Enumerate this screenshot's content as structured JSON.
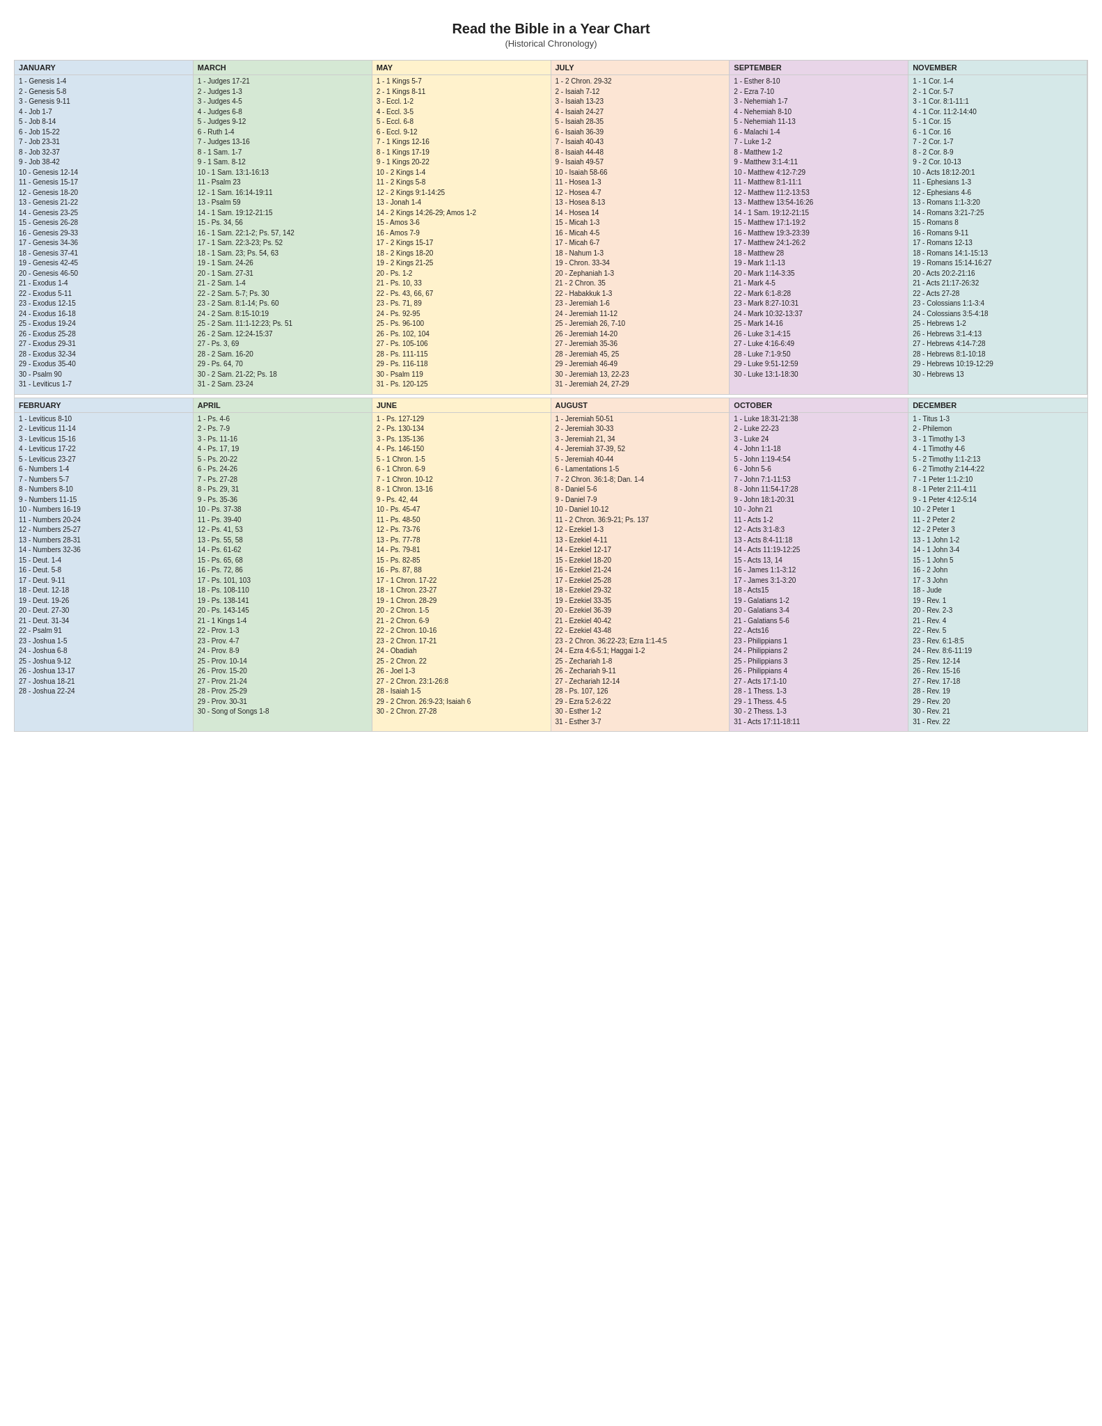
{
  "title": "Read the Bible in a Year Chart",
  "subtitle": "(Historical Chronology)",
  "months": {
    "january": {
      "label": "JANUARY",
      "entries": [
        "1 - Genesis 1-4",
        "2 - Genesis 5-8",
        "3 - Genesis 9-11",
        "4 - Job 1-7",
        "5 - Job 8-14",
        "6 - Job 15-22",
        "7 - Job 23-31",
        "8 - Job 32-37",
        "9 - Job 38-42",
        "10 - Genesis 12-14",
        "11 - Genesis 15-17",
        "12 - Genesis 18-20",
        "13 - Genesis 21-22",
        "14 - Genesis 23-25",
        "15 - Genesis 26-28",
        "16 - Genesis 29-33",
        "17 - Genesis 34-36",
        "18 - Genesis 37-41",
        "19 - Genesis 42-45",
        "20 - Genesis 46-50",
        "21 - Exodus 1-4",
        "22 - Exodus 5-11",
        "23 - Exodus 12-15",
        "24 - Exodus 16-18",
        "25 - Exodus 19-24",
        "26 - Exodus 25-28",
        "27 - Exodus 29-31",
        "28 - Exodus 32-34",
        "29 - Exodus 35-40",
        "30 - Psalm 90",
        "31 - Leviticus 1-7"
      ]
    },
    "february": {
      "label": "FEBRUARY",
      "entries": [
        "1 - Leviticus 8-10",
        "2 - Leviticus 11-14",
        "3 - Leviticus 15-16",
        "4 - Leviticus 17-22",
        "5 - Leviticus 23-27",
        "6 - Numbers 1-4",
        "7 - Numbers 5-7",
        "8 - Numbers 8-10",
        "9 - Numbers 11-15",
        "10 - Numbers 16-19",
        "11 - Numbers 20-24",
        "12 - Numbers 25-27",
        "13 - Numbers 28-31",
        "14 - Numbers 32-36",
        "15 - Deut. 1-4",
        "16 - Deut. 5-8",
        "17 - Deut. 9-11",
        "18 - Deut. 12-18",
        "19 - Deut. 19-26",
        "20 - Deut. 27-30",
        "21 - Deut. 31-34",
        "22 - Psalm 91",
        "23 - Joshua 1-5",
        "24 - Joshua 6-8",
        "25 - Joshua 9-12",
        "26 - Joshua 13-17",
        "27 - Joshua 18-21",
        "28 - Joshua 22-24"
      ]
    },
    "march": {
      "label": "MARCH",
      "entries": [
        "1 - Judges 17-21",
        "2 - Judges 1-3",
        "3 - Judges 4-5",
        "4 - Judges 6-8",
        "5 - Judges 9-12",
        "6 - Ruth 1-4",
        "7 - Judges 13-16",
        "8 - 1 Sam. 1-7",
        "9 - 1 Sam. 8-12",
        "10 - 1 Sam. 13:1-16:13",
        "11 - Psalm 23",
        "12 - 1 Sam. 16:14-19:11",
        "13 - Psalm 59",
        "14 - 1 Sam. 19:12-21:15",
        "15 - Ps. 34, 56",
        "16 - 1 Sam. 22:1-2; Ps. 57, 142",
        "17 - 1 Sam. 22:3-23; Ps. 52",
        "18 - 1 Sam. 23; Ps. 54, 63",
        "19 - 1 Sam. 24-26",
        "20 - 1 Sam. 27-31",
        "21 - 2 Sam. 1-4",
        "22 - 2 Sam. 5-7; Ps. 30",
        "23 - 2 Sam. 8:1-14; Ps. 60",
        "24 - 2 Sam. 8:15-10:19",
        "25 - 2 Sam. 11:1-12:23; Ps. 51",
        "26 - 2 Sam. 12:24-15:37",
        "27 - Ps. 3, 69",
        "28 - 2 Sam. 16-20",
        "29 - Ps. 64, 70",
        "30 - 2 Sam. 21-22; Ps. 18",
        "31 - 2 Sam. 23-24"
      ]
    },
    "april": {
      "label": "APRIL",
      "entries": [
        "1 - Ps. 4-6",
        "2 - Ps. 7-9",
        "3 - Ps. 11-16",
        "4 - Ps. 17, 19",
        "5 - Ps. 20-22",
        "6 - Ps. 24-26",
        "7 - Ps. 27-28",
        "8 - Ps. 29, 31",
        "9 - Ps. 35-36",
        "10 - Ps. 37-38",
        "11 - Ps. 39-40",
        "12 - Ps. 41, 53",
        "13 - Ps. 55, 58",
        "14 - Ps. 61-62",
        "15 - Ps. 65, 68",
        "16 - Ps. 72, 86",
        "17 - Ps. 101, 103",
        "18 - Ps. 108-110",
        "19 - Ps. 138-141",
        "20 - Ps. 143-145",
        "21 - 1 Kings 1-4",
        "22 - Prov. 1-3",
        "23 - Prov. 4-7",
        "24 - Prov. 8-9",
        "25 - Prov. 10-14",
        "26 - Prov. 15-20",
        "27 - Prov. 21-24",
        "28 - Prov. 25-29",
        "29 - Prov. 30-31",
        "30 - Song of Songs 1-8"
      ]
    },
    "may": {
      "label": "MAY",
      "entries": [
        "1 - 1 Kings 5-7",
        "2 - 1 Kings 8-11",
        "3 - Eccl. 1-2",
        "4 - Eccl. 3-5",
        "5 - Eccl. 6-8",
        "6 - Eccl. 9-12",
        "7 - 1 Kings 12-16",
        "8 - 1 Kings 17-19",
        "9 - 1 Kings 20-22",
        "10 - 2 Kings 1-4",
        "11 - 2 Kings 5-8",
        "12 - 2 Kings 9:1-14:25",
        "13 - Jonah 1-4",
        "14 - 2 Kings 14:26-29; Amos 1-2",
        "15 - Amos 3-6",
        "16 - Amos 7-9",
        "17 - 2 Kings 15-17",
        "18 - 2 Kings 18-20",
        "19 - 2 Kings 21-25",
        "20 - Ps. 1-2",
        "21 - Ps. 10, 33",
        "22 - Ps. 43, 66, 67",
        "23 - Ps. 71, 89",
        "24 - Ps. 92-95",
        "25 - Ps. 96-100",
        "26 - Ps. 102, 104",
        "27 - Ps. 105-106",
        "28 - Ps. 111-115",
        "29 - Ps. 116-118",
        "30 - Psalm 119",
        "31 - Ps. 120-125"
      ]
    },
    "june": {
      "label": "JUNE",
      "entries": [
        "1 - Ps. 127-129",
        "2 - Ps. 130-134",
        "3 - Ps. 135-136",
        "4 - Ps. 146-150",
        "5 - 1 Chron. 1-5",
        "6 - 1 Chron. 6-9",
        "7 - 1 Chron. 10-12",
        "8 - 1 Chron. 13-16",
        "9 - Ps. 42, 44",
        "10 - Ps. 45-47",
        "11 - Ps. 48-50",
        "12 - Ps. 73-76",
        "13 - Ps. 77-78",
        "14 - Ps. 79-81",
        "15 - Ps. 82-85",
        "16 - Ps. 87, 88",
        "17 - 1 Chron. 17-22",
        "18 - 1 Chron. 23-27",
        "19 - 1 Chron. 28-29",
        "20 - 2 Chron. 1-5",
        "21 - 2 Chron. 6-9",
        "22 - 2 Chron. 10-16",
        "23 - 2 Chron. 17-21",
        "24 - Obadiah",
        "25 - 2 Chron. 22",
        "26 - Joel 1-3",
        "27 - 2 Chron. 23:1-26:8",
        "28 - Isaiah 1-5",
        "29 - 2 Chron. 26:9-23; Isaiah 6",
        "30 - 2 Chron. 27-28"
      ]
    },
    "july": {
      "label": "JULY",
      "entries": [
        "1 - 2 Chron. 29-32",
        "2 - Isaiah 7-12",
        "3 - Isaiah 13-23",
        "4 - Isaiah 24-27",
        "5 - Isaiah 28-35",
        "6 - Isaiah 36-39",
        "7 - Isaiah 40-43",
        "8 - Isaiah 44-48",
        "9 - Isaiah 49-57",
        "10 - Isaiah 58-66",
        "11 - Hosea 1-3",
        "12 - Hosea 4-7",
        "13 - Hosea 8-13",
        "14 - Hosea 14",
        "15 - Micah 1-3",
        "16 - Micah 4-5",
        "17 - Micah 6-7",
        "18 - Nahum 1-3",
        "19 - Chron. 33-34",
        "20 - Zephaniah 1-3",
        "21 - 2 Chron. 35",
        "22 - Habakkuk 1-3",
        "23 - Jeremiah 1-6",
        "24 - Jeremiah 11-12",
        "25 - Jeremiah 26, 7-10",
        "26 - Jeremiah 14-20",
        "27 - Jeremiah 35-36",
        "28 - Jeremiah 45, 25",
        "29 - Jeremiah 46-49",
        "30 - Jeremiah 13, 22-23",
        "31 - Jeremiah 24, 27-29"
      ]
    },
    "august": {
      "label": "AUGUST",
      "entries": [
        "1 - Jeremiah 50-51",
        "2 - Jeremiah 30-33",
        "3 - Jeremiah 21, 34",
        "4 - Jeremiah 37-39, 52",
        "5 - Jeremiah 40-44",
        "6 - Lamentations 1-5",
        "7 - 2 Chron. 36:1-8; Dan. 1-4",
        "8 - Daniel 5-6",
        "9 - Daniel 7-9",
        "10 - Daniel 10-12",
        "11 - 2 Chron. 36:9-21; Ps. 137",
        "12 - Ezekiel 1-3",
        "13 - Ezekiel 4-11",
        "14 - Ezekiel 12-17",
        "15 - Ezekiel 18-20",
        "16 - Ezekiel 21-24",
        "17 - Ezekiel 25-28",
        "18 - Ezekiel 29-32",
        "19 - Ezekiel 33-35",
        "20 - Ezekiel 36-39",
        "21 - Ezekiel 40-42",
        "22 - Ezekiel 43-48",
        "23 - 2 Chron. 36:22-23; Ezra 1:1-4:5",
        "24 - Ezra 4:6-5:1; Haggai 1-2",
        "25 - Zechariah 1-8",
        "26 - Zechariah 9-11",
        "27 - Zechariah 12-14",
        "28 - Ps. 107, 126",
        "29 - Ezra 5:2-6:22",
        "30 - Esther 1-2",
        "31 - Esther 3-7"
      ]
    },
    "september": {
      "label": "SEPTEMBER",
      "entries": [
        "1 - Esther 8-10",
        "2 - Ezra 7-10",
        "3 - Nehemiah 1-7",
        "4 - Nehemiah 8-10",
        "5 - Nehemiah 11-13",
        "6 - Malachi 1-4",
        "7 - Luke 1-2",
        "8 - Matthew 1-2",
        "9 - Matthew 3:1-4:11",
        "10 - Matthew 4:12-7:29",
        "11 - Matthew 8:1-11:1",
        "12 - Matthew 11:2-13:53",
        "13 - Matthew 13:54-16:26",
        "14 - 1 Sam. 19:12-21:15",
        "15 - Matthew 17:1-19:2",
        "16 - Matthew 19:3-23:39",
        "17 - Matthew 24:1-26:2",
        "18 - Matthew 28",
        "19 - Mark 1:1-13",
        "20 - Mark 1:14-3:35",
        "21 - Mark 4-5",
        "22 - Mark 6:1-8:28",
        "23 - Mark 8:27-10:31",
        "24 - Mark 10:32-13:37",
        "25 - Mark 14-16",
        "26 - Luke 3:1-4:15",
        "27 - Luke 4:16-6:49",
        "28 - Luke 7:1-9:50",
        "29 - Luke 9:51-12:59",
        "30 - Luke 13:1-18:30"
      ]
    },
    "october": {
      "label": "OCTOBER",
      "entries": [
        "1 - Luke 18:31-21:38",
        "2 - Luke 22-23",
        "3 - Luke 24",
        "4 - John 1:1-18",
        "5 - John 1:19-4:54",
        "6 - John 5-6",
        "7 - John 7:1-11:53",
        "8 - John 11:54-17:28",
        "9 - John 18:1-20:31",
        "10 - John 21",
        "11 - Acts 1-2",
        "12 - Acts 3:1-8:3",
        "13 - Acts 8:4-11:18",
        "14 - Acts 11:19-12:25",
        "15 - Acts 13, 14",
        "16 - James 1:1-3:12",
        "17 - James 3:1-3:20",
        "18 - Acts15",
        "19 - Galatians 1-2",
        "20 - Galatians 3-4",
        "21 - Galatians 5-6",
        "22 - Acts16",
        "23 - Philippians 1",
        "24 - Philippians 2",
        "25 - Philippians 3",
        "26 - Philippians 4",
        "27 - Acts 17:1-10",
        "28 - 1 Thess. 1-3",
        "29 - 1 Thess. 4-5",
        "30 - 2 Thess. 1-3",
        "31 - Acts 17:11-18:11"
      ]
    },
    "november": {
      "label": "NOVEMBER",
      "entries": [
        "1 - 1 Cor. 1-4",
        "2 - 1 Cor. 5-7",
        "3 - 1 Cor. 8:1-11:1",
        "4 - 1 Cor. 11:2-14:40",
        "5 - 1 Cor. 15",
        "6 - 1 Cor. 16",
        "7 - 2 Cor. 1-7",
        "8 - 2 Cor. 8-9",
        "9 - 2 Cor. 10-13",
        "10 - Acts 18:12-20:1",
        "11 - Ephesians 1-3",
        "12 - Ephesians 4-6",
        "13 - Romans 1:1-3:20",
        "14 - Romans 3:21-7:25",
        "15 - Romans 8",
        "16 - Romans 9-11",
        "17 - Romans 12-13",
        "18 - Romans 14:1-15:13",
        "19 - Romans 15:14-16:27",
        "20 - Acts 20:2-21:16",
        "21 - Acts 21:17-26:32",
        "22 - Acts 27-28",
        "23 - Colossians 1:1-3:4",
        "24 - Colossians 3:5-4:18",
        "25 - Hebrews 1-2",
        "26 - Hebrews 3:1-4:13",
        "27 - Hebrews 4:14-7:28",
        "28 - Hebrews 8:1-10:18",
        "29 - Hebrews 10:19-12:29",
        "30 - Hebrews 13"
      ]
    },
    "december": {
      "label": "DECEMBER",
      "entries": [
        "1 - Titus 1-3",
        "2 - Philemon",
        "3 - 1 Timothy 1-3",
        "4 - 1 Timothy 4-6",
        "5 - 2 Timothy 1:1-2:13",
        "6 - 2 Timothy 2:14-4:22",
        "7 - 1 Peter 1:1-2:10",
        "8 - 1 Peter 2:11-4:11",
        "9 - 1 Peter 4:12-5:14",
        "10 - 2 Peter 1",
        "11 - 2 Peter 2",
        "12 - 2 Peter 3",
        "13 - 1 John 1-2",
        "14 - 1 John 3-4",
        "15 - 1 John 5",
        "16 - 2 John",
        "17 - 3 John",
        "18 - Jude",
        "19 - Rev. 1",
        "20 - Rev. 2-3",
        "21 - Rev. 4",
        "22 - Rev. 5",
        "23 - Rev. 6:1-8:5",
        "24 - Rev. 8:6-11:19",
        "25 - Rev. 12-14",
        "26 - Rev. 15-16",
        "27 - Rev. 17-18",
        "28 - Rev. 19",
        "29 - Rev. 20",
        "30 - Rev. 21",
        "31 - Rev. 22"
      ]
    }
  }
}
